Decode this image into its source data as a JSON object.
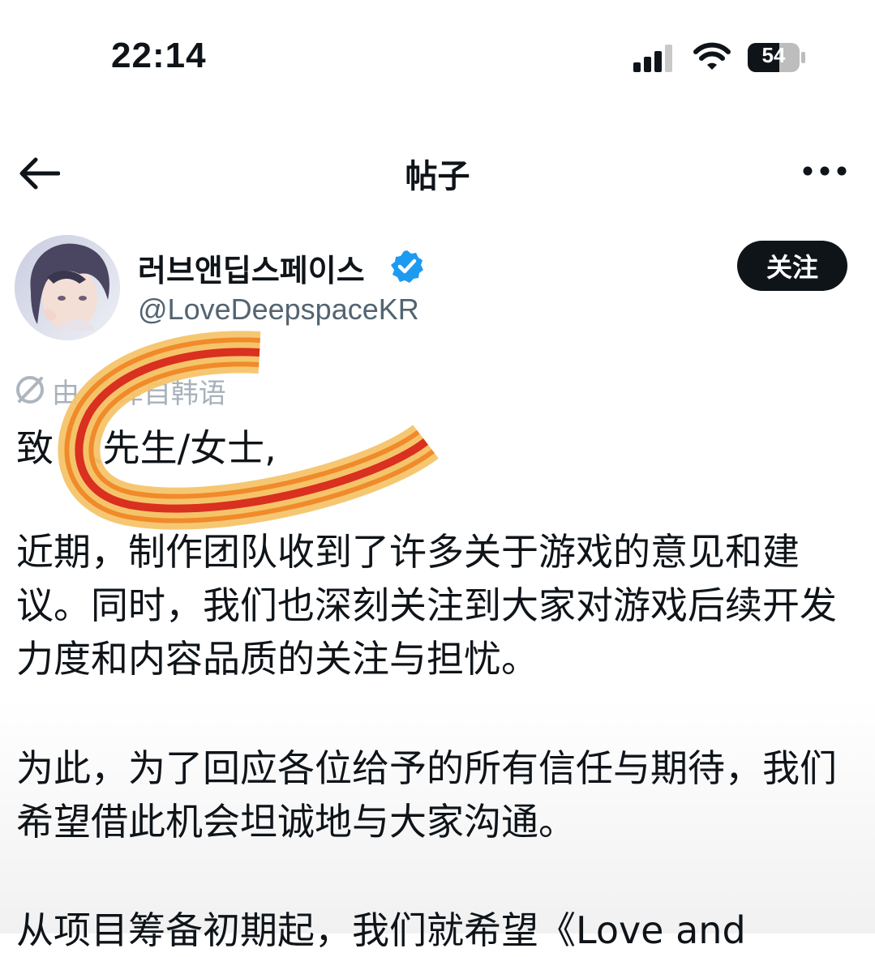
{
  "status_bar": {
    "time": "22:14",
    "battery_level": "54",
    "icons": [
      "cellular-signal-icon",
      "wifi-icon",
      "battery-icon"
    ]
  },
  "nav": {
    "title": "帖子",
    "icons": [
      "back-arrow-icon",
      "more-options-icon"
    ]
  },
  "author": {
    "display_name": "러브앤딥스페이스",
    "handle": "@LoveDeepspaceKR",
    "verified": true,
    "follow_label": "关注"
  },
  "translation_note": "由 翻译自韩语",
  "post": {
    "greeting": "致 人先生/女士,",
    "paragraph_1": "近期，制作团队收到了许多关于游戏的意见和建议。同时，我们也深刻关注到大家对游戏后续开发力度和内容品质的关注与担忧。",
    "paragraph_2": "为此，为了回应各位给予的所有信任与期待，我们希望借此机会坦诚地与大家沟通。",
    "paragraph_3": "从项目筹备初期起，我们就希望《Love and"
  },
  "colors": {
    "text": "#0f1419",
    "secondary_text": "#536471",
    "verified_blue": "#1d9bf0",
    "follow_button_bg": "#0f1419",
    "scribble_red": "#d9301f",
    "scribble_orange": "#f08a2a",
    "scribble_yellow": "#f5c46a"
  }
}
